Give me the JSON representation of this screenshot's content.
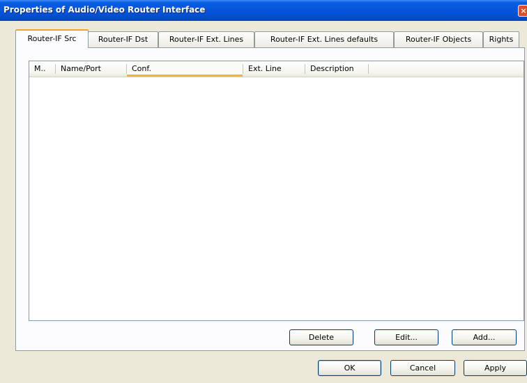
{
  "window": {
    "title": "Properties of Audio/Video Router Interface",
    "close_glyph": "×"
  },
  "tabs": [
    {
      "label": "Router-IF Src",
      "active": true
    },
    {
      "label": "Router-IF Dst",
      "active": false
    },
    {
      "label": "Router-IF Ext. Lines",
      "active": false
    },
    {
      "label": "Router-IF Ext. Lines defaults",
      "active": false
    },
    {
      "label": "Router-IF Objects",
      "active": false
    },
    {
      "label": "Rights",
      "active": false
    }
  ],
  "list": {
    "columns": [
      "M..",
      "Name/Port",
      "Conf.",
      "Ext. Line",
      "Description"
    ],
    "rows": []
  },
  "panel_buttons": {
    "delete": "Delete",
    "edit": "Edit...",
    "add": "Add..."
  },
  "dialog_buttons": {
    "ok": "OK",
    "cancel": "Cancel",
    "apply": "Apply"
  },
  "colors": {
    "titlebar": "#0553d8",
    "tab_highlight": "#f0a332",
    "face": "#ece9d8"
  }
}
